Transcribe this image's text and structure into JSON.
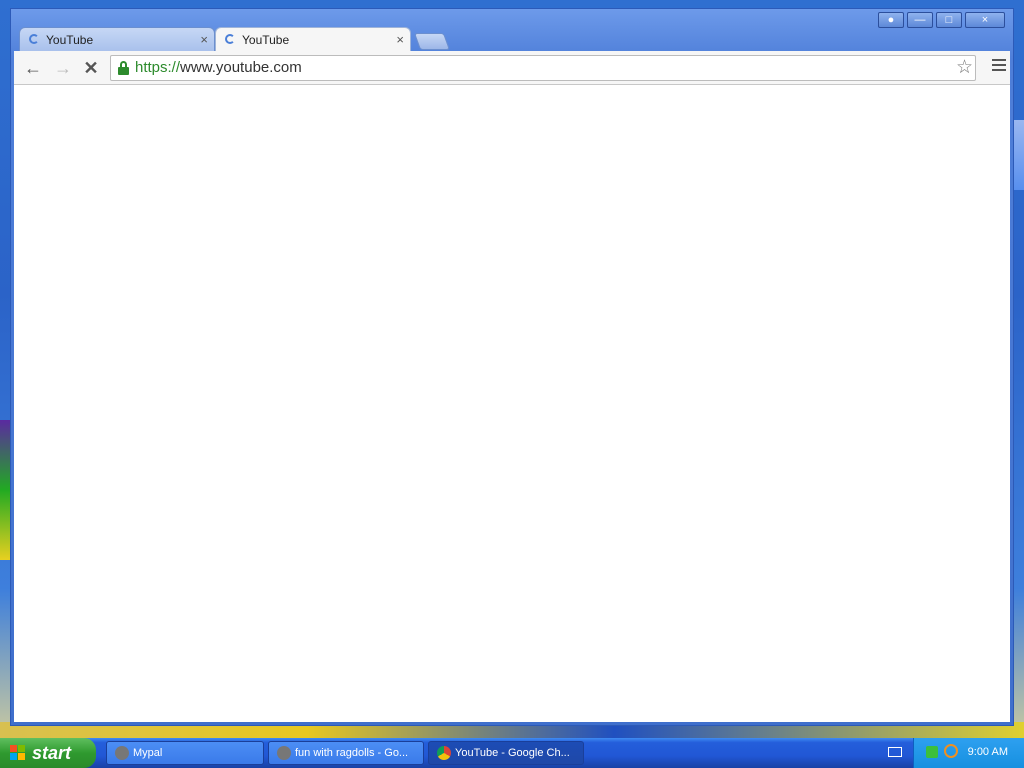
{
  "browser": {
    "tabs": [
      {
        "title": "YouTube",
        "state": "inactive"
      },
      {
        "title": "YouTube",
        "state": "active"
      }
    ],
    "tab_close_glyph": "×",
    "url_scheme": "https://",
    "url_rest": "www.youtube.com",
    "window_buttons": [
      "user-icon",
      "minimize-icon",
      "maximize-icon",
      "close-icon"
    ]
  },
  "taskbar": {
    "start_label": "start",
    "tasks": [
      {
        "label": "Mypal",
        "active": false
      },
      {
        "label": "fun with ragdolls - Go...",
        "active": false
      },
      {
        "label": "YouTube - Google Ch...",
        "active": true
      }
    ],
    "clock": "9:00 AM"
  },
  "colors": {
    "accent": "#245edb",
    "secure": "#2d8b2d",
    "start_green": "#2f9a2f"
  }
}
